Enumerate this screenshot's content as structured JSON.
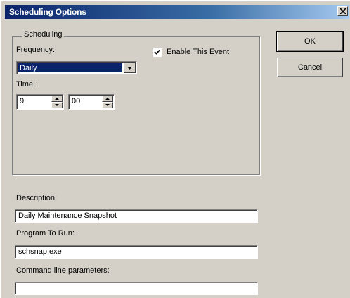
{
  "window": {
    "title": "Scheduling Options",
    "close_glyph": "x"
  },
  "scheduling_group": {
    "legend": "Scheduling",
    "frequency_label": "Frequency:",
    "frequency_value": "Daily",
    "enable_label": "Enable This Event",
    "enable_checked": true,
    "time_label": "Time:",
    "hour": "9",
    "minute": "00"
  },
  "description": {
    "label": "Description:",
    "value": "Daily Maintenance Snapshot"
  },
  "program": {
    "label": "Program To Run:",
    "value": "schsnap.exe"
  },
  "cmdline": {
    "label": "Command line parameters:",
    "value": ""
  },
  "buttons": {
    "ok": "OK",
    "cancel": "Cancel"
  },
  "colors": {
    "titlebar": "#0a246a",
    "face": "#d4d0c8",
    "selection": "#0a246a"
  }
}
